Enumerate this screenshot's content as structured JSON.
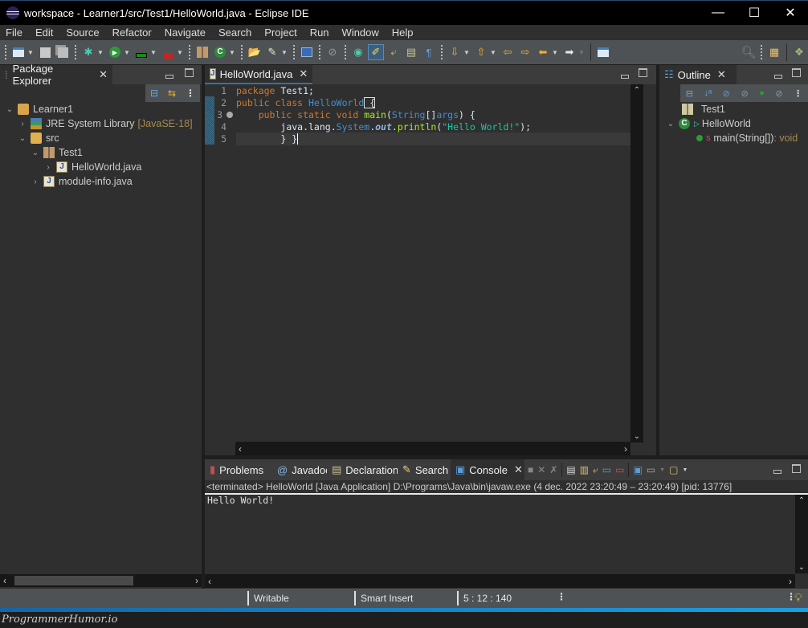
{
  "window": {
    "title": "workspace - Learner1/src/Test1/HelloWorld.java - Eclipse IDE",
    "minimize": "—",
    "maximize": "☐",
    "close": "✕"
  },
  "menu": [
    "File",
    "Edit",
    "Source",
    "Refactor",
    "Navigate",
    "Search",
    "Project",
    "Run",
    "Window",
    "Help"
  ],
  "toolbar": {
    "icons": [
      "new-icon",
      "save-icon",
      "save-all-icon",
      "debug-icon",
      "run-icon",
      "coverage-icon",
      "external-tools-icon",
      "new-package-icon",
      "new-class-icon",
      "open-type-icon",
      "open-task-icon",
      "console-icon",
      "skip-breakpoints-icon",
      "open-perspective-icon",
      "toggle-mark-occurrences-icon",
      "toggle-block-selection-icon",
      "show-whitespace-icon",
      "next-annotation-icon",
      "previous-annotation-icon",
      "last-edit-icon",
      "next-edit-icon",
      "back-icon",
      "forward-icon",
      "pin-editor-icon",
      "search-icon",
      "open-perspective-icon",
      "java-perspective-icon"
    ]
  },
  "package_explorer": {
    "tab_label": "Package Explorer",
    "tree": [
      {
        "label": "Learner1",
        "expanded": true,
        "icon": "project-icon"
      },
      {
        "label": "JRE System Library",
        "decoration": "[JavaSE-18]",
        "expanded": false,
        "icon": "library-icon"
      },
      {
        "label": "src",
        "expanded": true,
        "icon": "source-folder-icon"
      },
      {
        "label": "Test1",
        "expanded": true,
        "icon": "package-icon"
      },
      {
        "label": "HelloWorld.java",
        "expanded": false,
        "icon": "java-file-icon"
      },
      {
        "label": "module-info.java",
        "expanded": false,
        "icon": "java-file-icon"
      }
    ]
  },
  "editor": {
    "tab_label": "HelloWorld.java",
    "line_numbers": [
      "1",
      "2",
      "3",
      "4",
      "5"
    ],
    "lines": {
      "l1": {
        "kw": "package",
        "rest": " Test1;"
      },
      "l2": {
        "kw": "public class",
        "type": "HelloWorld",
        "rest": " {"
      },
      "l3": {
        "indent": "    ",
        "kw": "public static void",
        "fn": "main",
        "p1": "(",
        "type": "String",
        "p2": "[]",
        "arg": "args",
        "p3": ") {"
      },
      "l4": {
        "indent": "        ",
        "p1": "java.lang.",
        "type": "System",
        "p2": ".",
        "field": "out",
        "p3": ".",
        "fn": "println",
        "p4": "(",
        "str": "\"Hello World!\"",
        "p5": ");"
      },
      "l5": {
        "indent": "        ",
        "text": "} }"
      }
    }
  },
  "outline": {
    "tab_label": "Outline",
    "items": [
      {
        "label": "Test1",
        "icon": "package-icon"
      },
      {
        "label": "HelloWorld",
        "icon": "class-icon",
        "expanded": true
      },
      {
        "label": "main(String[])",
        "suffix": " : void",
        "icon": "public-method-icon"
      }
    ]
  },
  "bottom_panel": {
    "tabs": [
      "Problems",
      "Javadoc",
      "Declaration",
      "Search",
      "Console"
    ],
    "active_tab": "Console",
    "console_header": "<terminated> HelloWorld [Java Application] D:\\Programs\\Java\\bin\\javaw.exe  (4 dec. 2022 23:20:49 – 23:20:49) [pid: 13776]",
    "console_output": "Hello World!"
  },
  "status": {
    "writable": "Writable",
    "insert_mode": "Smart Insert",
    "position": "5 : 12 : 140"
  },
  "watermark": "ProgrammerHumor.io"
}
